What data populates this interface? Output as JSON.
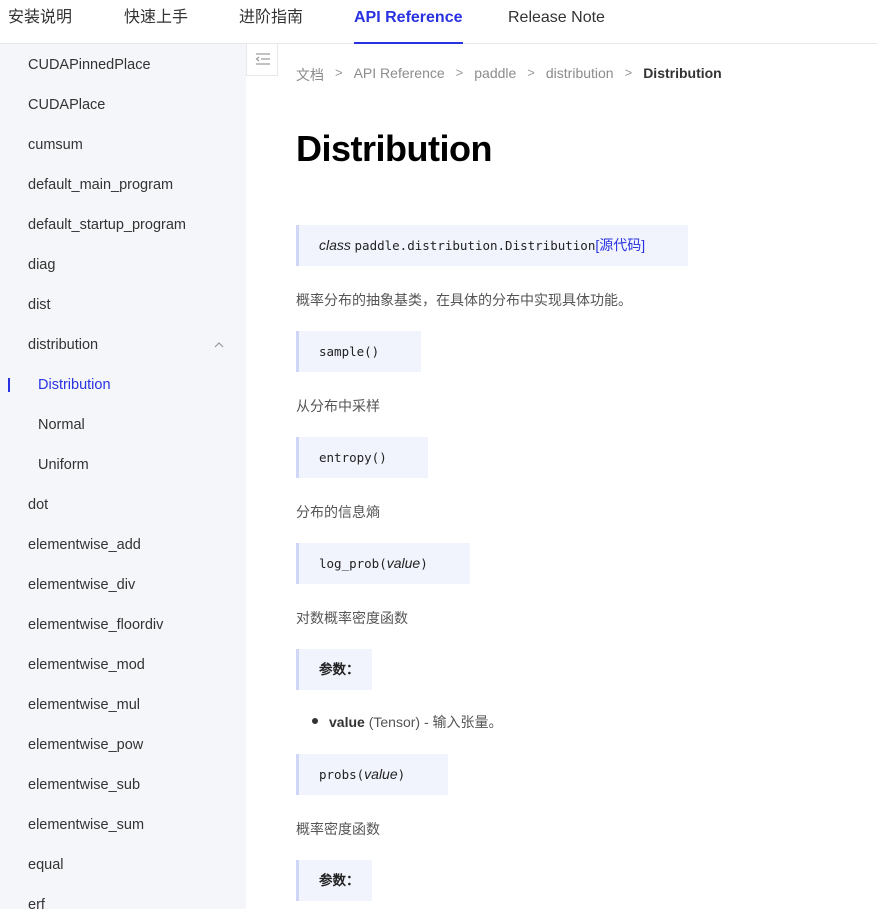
{
  "nav": {
    "tabs": [
      {
        "label": "安装说明"
      },
      {
        "label": "快速上手"
      },
      {
        "label": "进阶指南"
      },
      {
        "label": "API Reference",
        "active": true
      },
      {
        "label": "Release Note"
      }
    ]
  },
  "sidebar": {
    "items": [
      {
        "label": "CUDAPinnedPlace"
      },
      {
        "label": "CUDAPlace"
      },
      {
        "label": "cumsum"
      },
      {
        "label": "default_main_program"
      },
      {
        "label": "default_startup_program"
      },
      {
        "label": "diag"
      },
      {
        "label": "dist"
      },
      {
        "label": "distribution",
        "expanded": true
      },
      {
        "label": "Distribution",
        "sub": true,
        "active": true
      },
      {
        "label": "Normal",
        "sub": true
      },
      {
        "label": "Uniform",
        "sub": true
      },
      {
        "label": "dot"
      },
      {
        "label": "elementwise_add"
      },
      {
        "label": "elementwise_div"
      },
      {
        "label": "elementwise_floordiv"
      },
      {
        "label": "elementwise_mod"
      },
      {
        "label": "elementwise_mul"
      },
      {
        "label": "elementwise_pow"
      },
      {
        "label": "elementwise_sub"
      },
      {
        "label": "elementwise_sum"
      },
      {
        "label": "equal"
      },
      {
        "label": "erf"
      }
    ]
  },
  "breadcrumb": [
    "文档",
    "API Reference",
    "paddle",
    "distribution",
    "Distribution"
  ],
  "content": {
    "title": "Distribution",
    "class_sig": {
      "keyword": "class",
      "name": "paddle.distribution.Distribution",
      "source_link": "[源代码]"
    },
    "class_desc": "概率分布的抽象基类，在具体的分布中实现具体功能。",
    "methods": {
      "sample": {
        "name": "sample()",
        "desc": "从分布中采样"
      },
      "entropy": {
        "name": "entropy()",
        "desc": "分布的信息熵"
      },
      "log_prob": {
        "name": "log_prob(",
        "param": "value",
        "close": ")",
        "desc": "对数概率密度函数"
      },
      "probs": {
        "name": "probs(",
        "param": "value",
        "close": ")",
        "desc": "概率密度函数"
      }
    },
    "params_label": "参数：",
    "log_prob_param": {
      "name": "value",
      "type": "(Tensor)",
      "desc": " - 输入张量。"
    }
  },
  "colors": {
    "accent": "#2932e1",
    "sidebar_bg": "#f5f6f9",
    "code_bg": "#f2f4fd"
  }
}
